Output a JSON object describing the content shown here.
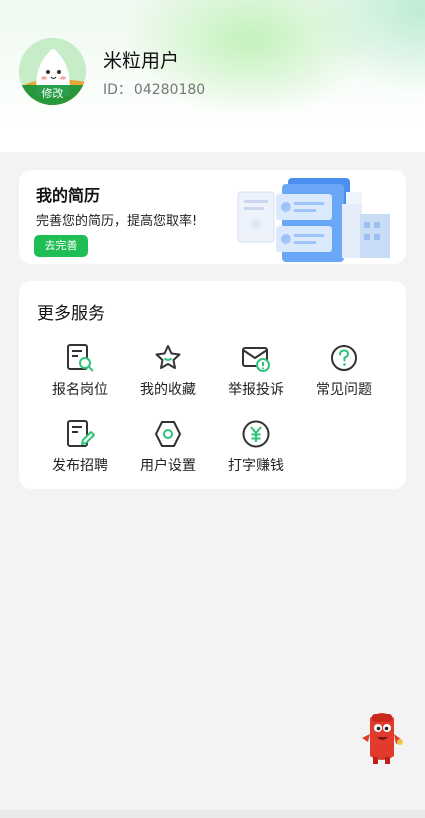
{
  "profile": {
    "name": "米粒用户",
    "id_label": "ID：",
    "id_value": "04280180",
    "avatar_edit_label": "修改"
  },
  "resume_card": {
    "title": "我的简历",
    "description": "完善您的简历，提高您取率!",
    "button_label": "去完善"
  },
  "services": {
    "title": "更多服务",
    "items": [
      {
        "label": "报名岗位",
        "icon": "application-search-icon"
      },
      {
        "label": "我的收藏",
        "icon": "star-icon"
      },
      {
        "label": "举报投诉",
        "icon": "report-envelope-icon"
      },
      {
        "label": "常见问题",
        "icon": "question-circle-icon"
      },
      {
        "label": "发布招聘",
        "icon": "post-job-icon"
      },
      {
        "label": "用户设置",
        "icon": "settings-hexagon-icon"
      },
      {
        "label": "打字赚钱",
        "icon": "yuan-coin-icon"
      }
    ]
  },
  "colors": {
    "accent_green": "#1fbe55",
    "icon_dark": "#333333",
    "icon_accent": "#2ec37a"
  }
}
